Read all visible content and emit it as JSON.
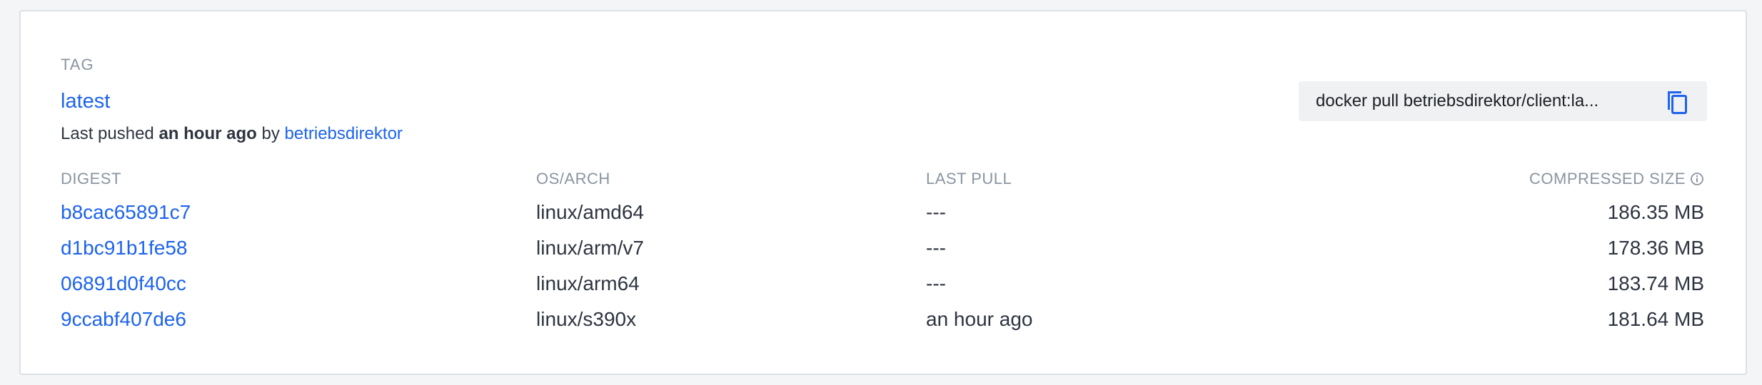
{
  "tag": {
    "section_label": "TAG",
    "name": "latest",
    "pushed_prefix": "Last pushed",
    "pushed_time": "an hour ago",
    "pushed_by_word": "by",
    "pushed_user": "betriebsdirektor"
  },
  "pull_command": {
    "text": "docker pull betriebsdirektor/client:la...",
    "copy_icon": "copy-icon"
  },
  "table": {
    "headers": {
      "digest": "DIGEST",
      "os_arch": "OS/ARCH",
      "last_pull": "LAST PULL",
      "compressed_size": "COMPRESSED SIZE",
      "info_icon": "info-icon"
    },
    "rows": [
      {
        "digest": "b8cac65891c7",
        "os_arch": "linux/amd64",
        "last_pull": "---",
        "size": "186.35 MB"
      },
      {
        "digest": "d1bc91b1fe58",
        "os_arch": "linux/arm/v7",
        "last_pull": "---",
        "size": "178.36 MB"
      },
      {
        "digest": "06891d0f40cc",
        "os_arch": "linux/arm64",
        "last_pull": "---",
        "size": "183.74 MB"
      },
      {
        "digest": "9ccabf407de6",
        "os_arch": "linux/s390x",
        "last_pull": "an hour ago",
        "size": "181.64 MB"
      }
    ]
  },
  "colors": {
    "link": "#1d63ed",
    "text": "#2e3440",
    "muted": "#8a94a0",
    "card_border": "#dcdfe4",
    "pull_box_bg": "#f0f1f3"
  }
}
